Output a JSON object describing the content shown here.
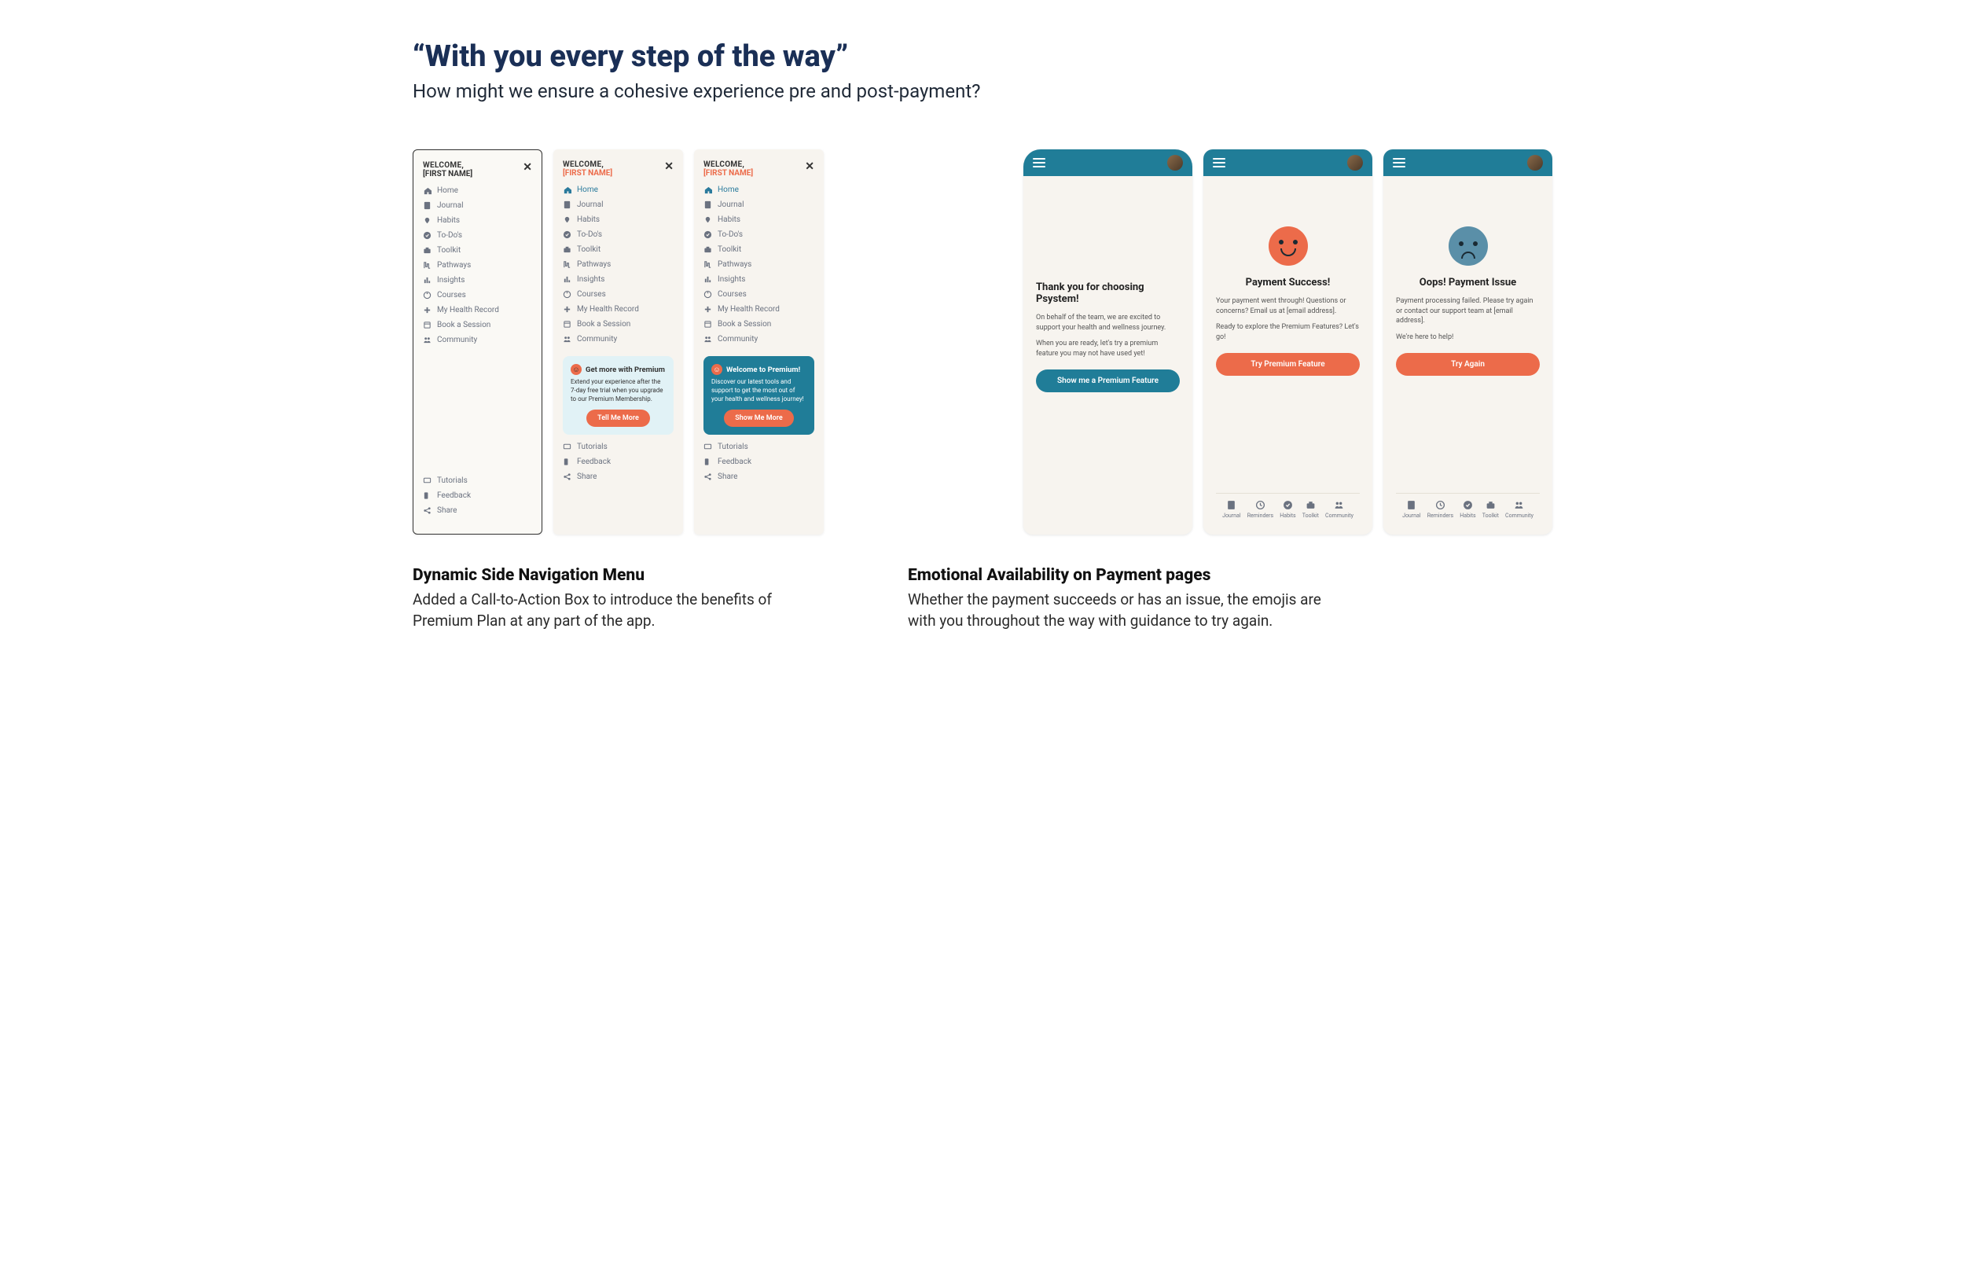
{
  "headline": "“With you every step of the way”",
  "sub": "How might we ensure a cohesive experience pre and post-payment?",
  "sidebar_common": {
    "welcome": "WELCOME,",
    "name_placeholder": "[FIRST NAME]",
    "close": "✕",
    "nav": [
      {
        "label": "Home",
        "icon": "home"
      },
      {
        "label": "Journal",
        "icon": "journal"
      },
      {
        "label": "Habits",
        "icon": "habits"
      },
      {
        "label": "To-Do's",
        "icon": "todo"
      },
      {
        "label": "Toolkit",
        "icon": "toolkit"
      },
      {
        "label": "Pathways",
        "icon": "pathways"
      },
      {
        "label": "Insights",
        "icon": "insights"
      },
      {
        "label": "Courses",
        "icon": "courses"
      },
      {
        "label": "My Health Record",
        "icon": "health"
      },
      {
        "label": "Book a Session",
        "icon": "book"
      },
      {
        "label": "Community",
        "icon": "community"
      }
    ],
    "footer": [
      {
        "label": "Tutorials",
        "icon": "tutorials"
      },
      {
        "label": "Feedback",
        "icon": "feedback"
      },
      {
        "label": "Share",
        "icon": "share"
      }
    ]
  },
  "cta_light": {
    "title": "Get more with Premium",
    "body": "Extend your experience after the 7-day free trial when you upgrade to our Premium Membership.",
    "button": "Tell Me More"
  },
  "cta_teal": {
    "title": "Welcome to Premium!",
    "body": "Discover our latest tools and support to get the most out of your health and wellness journey!",
    "button": "Show Me More"
  },
  "phone_thankyou": {
    "title": "Thank you for choosing Psystem!",
    "p1": "On behalf of the team, we are excited to support your health and wellness journey.",
    "p2": "When you are ready, let's try a premium feature you may not have used yet!",
    "button": "Show me a Premium Feature"
  },
  "phone_success": {
    "title": "Payment Success!",
    "p1": "Your payment went through! Questions or concerns? Email us at [email address].",
    "p2": "Ready to explore the Premium Features? Let's go!",
    "button": "Try Premium Feature"
  },
  "phone_issue": {
    "title": "Oops! Payment Issue",
    "p1": "Payment processing failed. Please try again or contact our support team at [email address].",
    "p2": "We're here to help!",
    "button": "Try Again"
  },
  "tabs": [
    "Journal",
    "Reminders",
    "Habits",
    "Toolkit",
    "Community"
  ],
  "caption_left": {
    "h": "Dynamic Side Navigation Menu",
    "p": "Added a Call-to-Action Box to introduce the benefits of Premium Plan at any part of the app."
  },
  "caption_right": {
    "h": "Emotional Availability on Payment pages",
    "p": "Whether the payment succeeds or has an issue, the emojis are with you throughout the way with guidance to try again."
  }
}
